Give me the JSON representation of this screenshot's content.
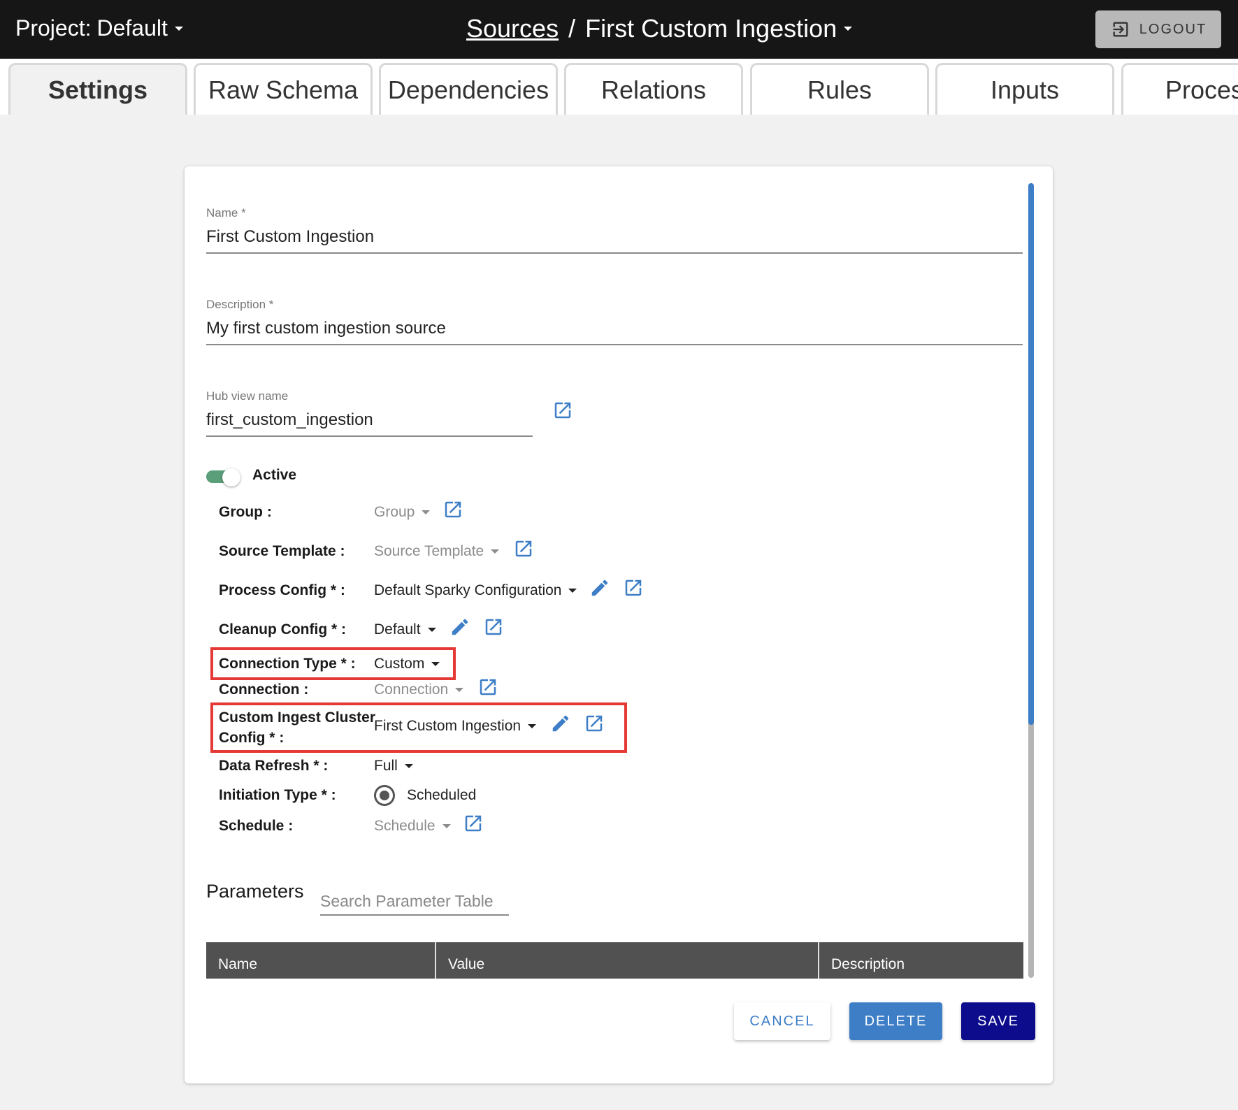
{
  "header": {
    "project_label": "Project:",
    "project_value": "Default",
    "breadcrumb_link": "Sources",
    "breadcrumb_sep": "/",
    "breadcrumb_current": "First Custom Ingestion",
    "logout_label": "LOGOUT"
  },
  "tabs": [
    {
      "label": "Settings",
      "active": true
    },
    {
      "label": "Raw Schema"
    },
    {
      "label": "Dependencies"
    },
    {
      "label": "Relations"
    },
    {
      "label": "Rules"
    },
    {
      "label": "Inputs"
    },
    {
      "label": "Process"
    }
  ],
  "form": {
    "name": {
      "label": "Name *",
      "value": "First Custom Ingestion"
    },
    "description": {
      "label": "Description *",
      "value": "My first custom ingestion source"
    },
    "hub_view": {
      "label": "Hub view name",
      "value": "first_custom_ingestion"
    },
    "active": {
      "label": "Active",
      "on": true
    },
    "rows": [
      {
        "label": "Group :",
        "value": "Group"
      },
      {
        "label": "Source Template :",
        "value": "Source Template"
      },
      {
        "label": "Process Config * :",
        "value": "Default Sparky Configuration"
      },
      {
        "label": "Cleanup Config * :",
        "value": "Default"
      },
      {
        "label": "Connection Type * :",
        "value": "Custom"
      },
      {
        "label": "Connection :",
        "value": "Connection"
      },
      {
        "label_line1": "Custom Ingest Cluster",
        "label_line2": "Config * :",
        "value": "First Custom Ingestion"
      },
      {
        "label": "Data Refresh * :",
        "value": "Full"
      },
      {
        "label": "Initiation Type * :",
        "value": "Scheduled"
      },
      {
        "label": "Schedule :",
        "value": "Schedule"
      }
    ]
  },
  "parameters": {
    "title": "Parameters",
    "search_placeholder": "Search Parameter Table",
    "columns": [
      "Name",
      "Value",
      "Description"
    ]
  },
  "actions": {
    "cancel": "CANCEL",
    "delete": "DELETE",
    "save": "SAVE"
  },
  "colors": {
    "accent": "#3d7ec7",
    "save": "#0c0c8c",
    "highlight": "#e53935",
    "toggle": "#5a9e7a"
  }
}
